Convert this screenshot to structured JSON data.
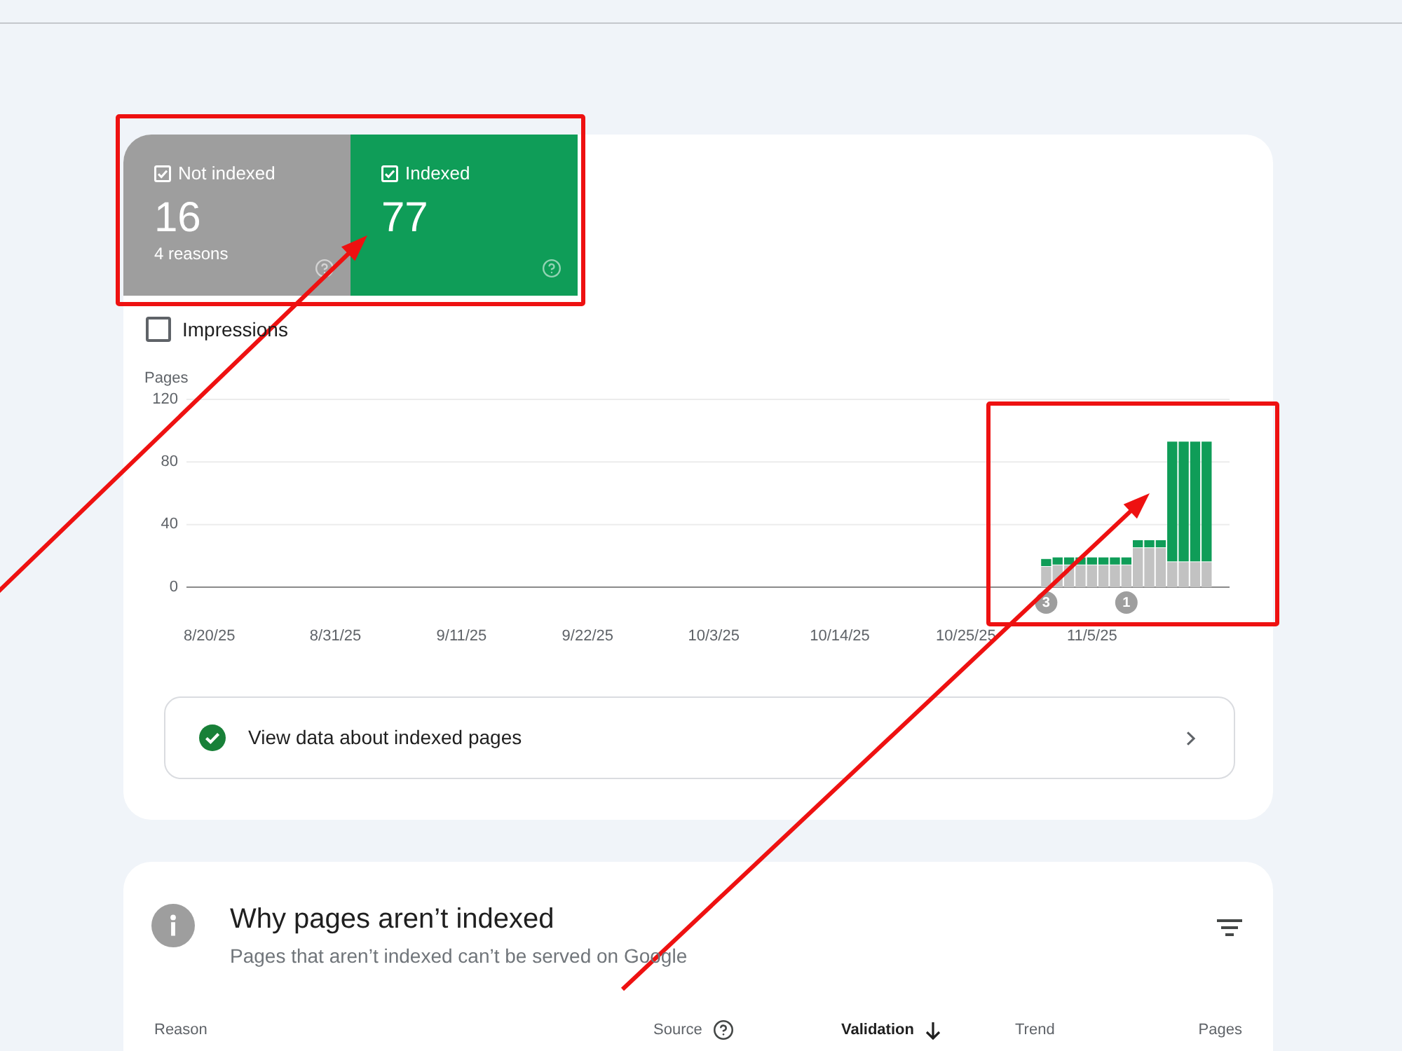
{
  "summary_cards": [
    {
      "label": "Not indexed",
      "checked": true,
      "count": "16",
      "detail": "4 reasons",
      "color": "#9e9e9e"
    },
    {
      "label": "Indexed",
      "checked": true,
      "count": "77",
      "color": "#0f9d58"
    }
  ],
  "impressions": {
    "label": "Impressions",
    "checked": false
  },
  "chart_data": {
    "type": "bar",
    "ylabel": "Pages",
    "categories": [
      null,
      null,
      "8/20/25",
      null,
      null,
      null,
      null,
      null,
      null,
      null,
      null,
      null,
      null,
      "8/31/25",
      null,
      null,
      null,
      null,
      null,
      null,
      null,
      null,
      null,
      null,
      "9/11/25",
      null,
      null,
      null,
      null,
      null,
      null,
      null,
      null,
      null,
      null,
      "9/22/25",
      null,
      null,
      null,
      null,
      null,
      null,
      null,
      null,
      null,
      null,
      "10/3/25",
      null,
      null,
      null,
      null,
      null,
      null,
      null,
      null,
      null,
      null,
      "10/14/25",
      null,
      null,
      null,
      null,
      null,
      null,
      null,
      null,
      null,
      null,
      "10/25/25",
      null,
      null,
      null,
      null,
      null,
      null,
      null,
      null,
      null,
      null,
      "11/5/25",
      null,
      null,
      null,
      null,
      null,
      null,
      null,
      null,
      null,
      null,
      null
    ],
    "ylim": [
      0,
      120
    ],
    "yticks": [
      0,
      40,
      80,
      120
    ],
    "stacked": true,
    "series": [
      {
        "color": "#c2c2c2",
        "values": [
          null,
          null,
          null,
          null,
          null,
          null,
          null,
          null,
          null,
          null,
          null,
          null,
          null,
          null,
          null,
          null,
          null,
          null,
          null,
          null,
          null,
          null,
          null,
          null,
          null,
          null,
          null,
          null,
          null,
          null,
          null,
          null,
          null,
          null,
          null,
          null,
          null,
          null,
          null,
          null,
          null,
          null,
          null,
          null,
          null,
          null,
          null,
          null,
          null,
          null,
          null,
          null,
          null,
          null,
          null,
          null,
          null,
          null,
          null,
          null,
          null,
          null,
          null,
          null,
          null,
          null,
          null,
          null,
          null,
          null,
          null,
          null,
          null,
          null,
          null,
          13,
          14,
          14,
          14,
          14,
          14,
          14,
          14,
          25,
          25,
          25,
          16,
          16,
          16,
          16,
          null
        ]
      },
      {
        "color": "#0f9d58",
        "values": [
          null,
          null,
          null,
          null,
          null,
          null,
          null,
          null,
          null,
          null,
          null,
          null,
          null,
          null,
          null,
          null,
          null,
          null,
          null,
          null,
          null,
          null,
          null,
          null,
          null,
          null,
          null,
          null,
          null,
          null,
          null,
          null,
          null,
          null,
          null,
          null,
          null,
          null,
          null,
          null,
          null,
          null,
          null,
          null,
          null,
          null,
          null,
          null,
          null,
          null,
          null,
          null,
          null,
          null,
          null,
          null,
          null,
          null,
          null,
          null,
          null,
          null,
          null,
          null,
          null,
          null,
          null,
          null,
          null,
          null,
          null,
          null,
          null,
          null,
          null,
          5,
          5,
          5,
          5,
          5,
          5,
          5,
          5,
          5,
          5,
          5,
          77,
          77,
          77,
          77,
          null
        ]
      }
    ],
    "annotations": [
      {
        "text": "3"
      },
      {
        "text": "1"
      }
    ]
  },
  "indexed_link": {
    "label": "View data about indexed pages"
  },
  "reasons_section": {
    "title": "Why pages aren’t indexed",
    "subtitle": "Pages that aren’t indexed can’t be served on Google",
    "columns": [
      {
        "label": "Reason",
        "help": false,
        "sorted": false
      },
      {
        "label": "Source",
        "help": true,
        "sorted": false
      },
      {
        "label": "Validation",
        "help": false,
        "sorted": true
      },
      {
        "label": "Trend",
        "help": false,
        "sorted": false
      },
      {
        "label": "Pages",
        "help": false,
        "sorted": false
      }
    ]
  },
  "annotations": [
    {
      "kind": "box"
    },
    {
      "kind": "box"
    },
    {
      "kind": "arrow"
    },
    {
      "kind": "arrow"
    }
  ]
}
